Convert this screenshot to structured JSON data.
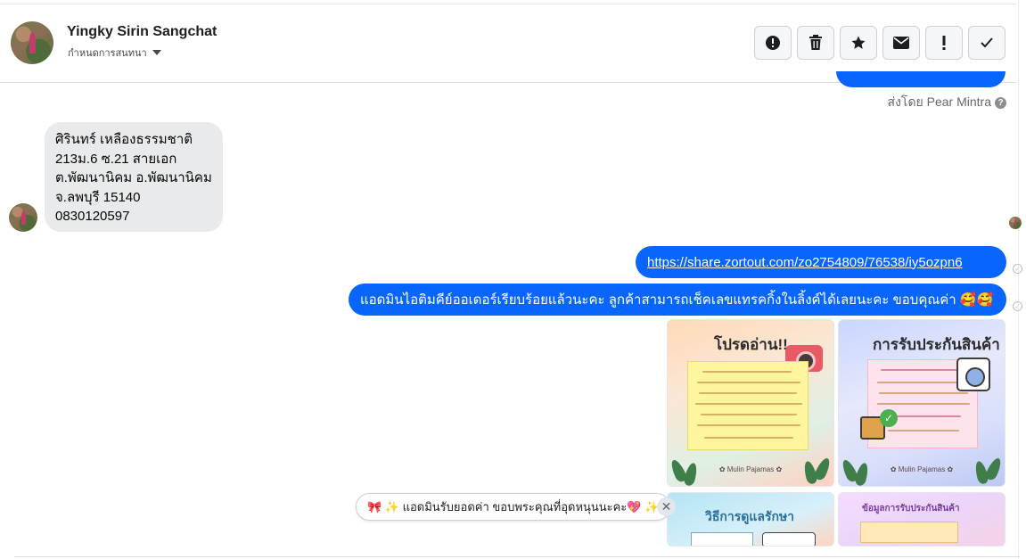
{
  "contact": {
    "name": "Yingky Sirin Sangchat",
    "subtitle": "กำหนดการสนทนา"
  },
  "toolbar": {
    "buttons": [
      {
        "icon": "report-icon",
        "glyph": "!"
      },
      {
        "icon": "trash-icon",
        "glyph": "🗑"
      },
      {
        "icon": "star-icon",
        "glyph": "★"
      },
      {
        "icon": "envelope-icon",
        "glyph": "✉"
      },
      {
        "icon": "exclamation-icon",
        "glyph": "!"
      },
      {
        "icon": "checkmark-icon",
        "glyph": "✓"
      }
    ]
  },
  "sent_by": {
    "label": "ส่งโดย Pear Mintra",
    "help_glyph": "?"
  },
  "incoming": {
    "lines": [
      "ศิรินทร์ เหลืองธรรมชาติ",
      "213ม.6 ซ.21 สายเอก",
      "ต.พัฒนานิคม อ.พัฒนานิคม",
      "จ.ลพบุรี 15140",
      "0830120597"
    ]
  },
  "outgoing": {
    "link": "https://share.zortout.com/zo2754809/76538/iy5ozpn6",
    "message": "แอดมินไอติมคีย์ออเดอร์เรียบร้อยแล้วนะคะ ลูกค้าสามารถเช็คเลขแทรคกิ้งในลิ้งค์ได้เลยนะคะ ขอบคุณค่า 🥰🥰"
  },
  "images": {
    "card1_title": "โปรดอ่าน!!",
    "card2_title": "การรับประกันสินค้า",
    "card3_title": "วิธีการดูแลรักษา",
    "card4_title": "ข้อมูลการรับประกันสินค้า",
    "brand": "✿ Mulin Pajamas ✿"
  },
  "quick_reply": {
    "text": "🎀 ✨ แอดมินรับยอดค่า ขอบพระคุณที่อุดหนุนนะคะ💖 ✨",
    "close_glyph": "✕"
  },
  "colors": {
    "accent": "#0866ff",
    "incoming_bubble": "#e9eaeb"
  }
}
